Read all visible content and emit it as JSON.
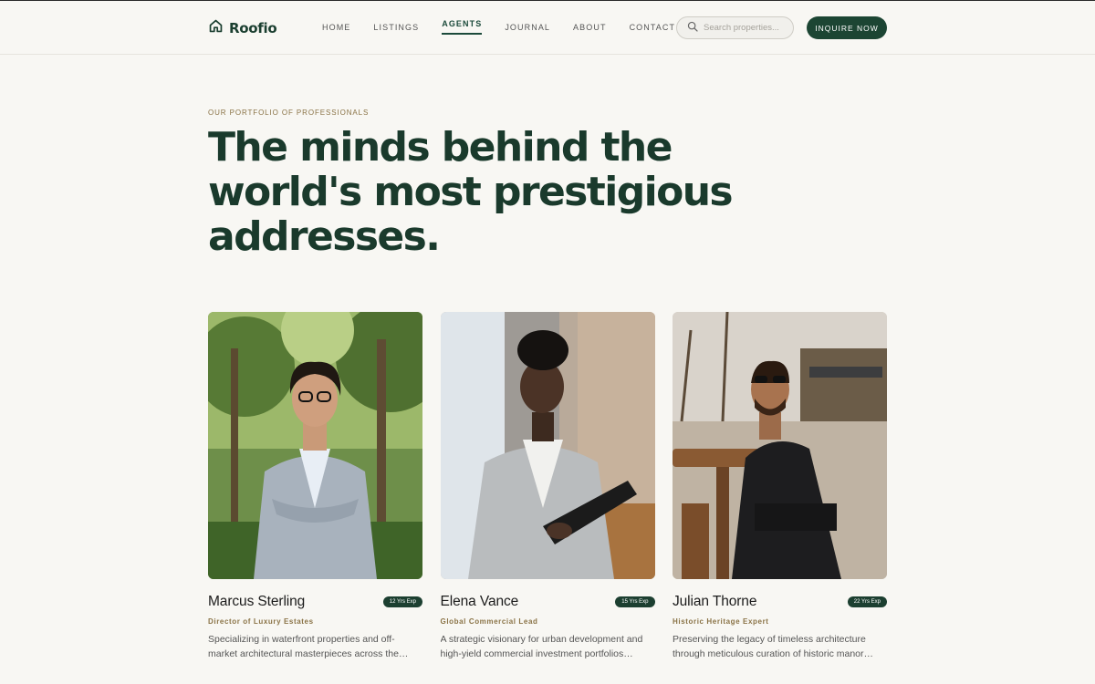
{
  "brand": {
    "name": "Roofio",
    "logo_icon": "home-icon",
    "accent": "#1c4533",
    "gold": "#8a7346"
  },
  "nav": [
    {
      "label": "HOME",
      "active": false
    },
    {
      "label": "LISTINGS",
      "active": false
    },
    {
      "label": "AGENTS",
      "active": true
    },
    {
      "label": "JOURNAL",
      "active": false
    },
    {
      "label": "ABOUT",
      "active": false
    },
    {
      "label": "CONTACT",
      "active": false
    }
  ],
  "search": {
    "placeholder": "Search properties...",
    "icon": "search-icon"
  },
  "cta": {
    "label": "INQUIRE NOW"
  },
  "hero": {
    "eyebrow": "OUR PORTFOLIO OF PROFESSIONALS",
    "headline_line1": "The minds behind the",
    "headline_line2": "world's most prestigious",
    "headline_line3": "addresses."
  },
  "agents": [
    {
      "name": "Marcus Sterling",
      "badge": "12 Yrs Exp",
      "role": "Director of Luxury Estates",
      "bio": "Specializing in waterfront properties and off-market architectural masterpieces across the coastline and beyond."
    },
    {
      "name": "Elena Vance",
      "badge": "15 Yrs Exp",
      "role": "Global Commercial Lead",
      "bio": "A strategic visionary for urban development and high-yield commercial investment portfolios worldwide."
    },
    {
      "name": "Julian Thorne",
      "badge": "22 Yrs Exp",
      "role": "Historic Heritage Expert",
      "bio": "Preserving the legacy of timeless architecture through meticulous curation of historic manor estates."
    }
  ]
}
